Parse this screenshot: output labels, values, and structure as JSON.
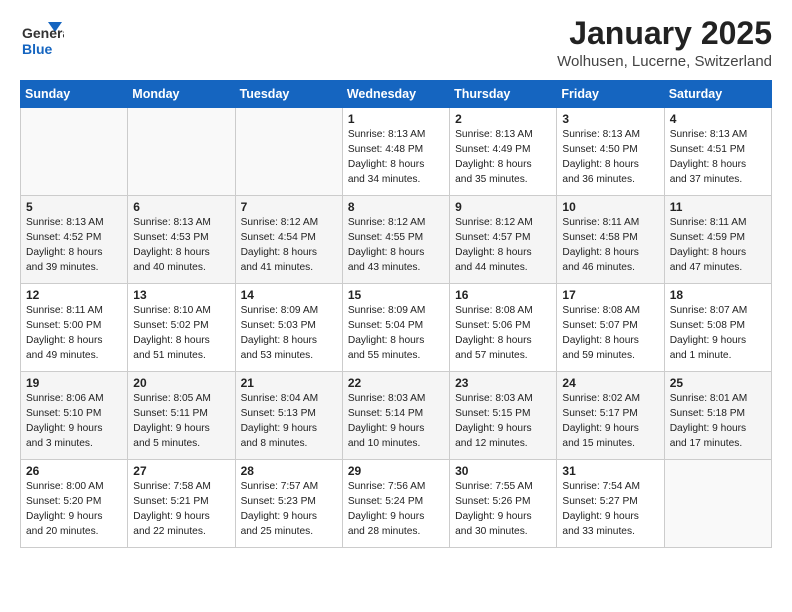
{
  "header": {
    "logo_general": "General",
    "logo_blue": "Blue",
    "month_title": "January 2025",
    "location": "Wolhusen, Lucerne, Switzerland"
  },
  "weekdays": [
    "Sunday",
    "Monday",
    "Tuesday",
    "Wednesday",
    "Thursday",
    "Friday",
    "Saturday"
  ],
  "weeks": [
    [
      {
        "day": "",
        "info": ""
      },
      {
        "day": "",
        "info": ""
      },
      {
        "day": "",
        "info": ""
      },
      {
        "day": "1",
        "info": "Sunrise: 8:13 AM\nSunset: 4:48 PM\nDaylight: 8 hours\nand 34 minutes."
      },
      {
        "day": "2",
        "info": "Sunrise: 8:13 AM\nSunset: 4:49 PM\nDaylight: 8 hours\nand 35 minutes."
      },
      {
        "day": "3",
        "info": "Sunrise: 8:13 AM\nSunset: 4:50 PM\nDaylight: 8 hours\nand 36 minutes."
      },
      {
        "day": "4",
        "info": "Sunrise: 8:13 AM\nSunset: 4:51 PM\nDaylight: 8 hours\nand 37 minutes."
      }
    ],
    [
      {
        "day": "5",
        "info": "Sunrise: 8:13 AM\nSunset: 4:52 PM\nDaylight: 8 hours\nand 39 minutes."
      },
      {
        "day": "6",
        "info": "Sunrise: 8:13 AM\nSunset: 4:53 PM\nDaylight: 8 hours\nand 40 minutes."
      },
      {
        "day": "7",
        "info": "Sunrise: 8:12 AM\nSunset: 4:54 PM\nDaylight: 8 hours\nand 41 minutes."
      },
      {
        "day": "8",
        "info": "Sunrise: 8:12 AM\nSunset: 4:55 PM\nDaylight: 8 hours\nand 43 minutes."
      },
      {
        "day": "9",
        "info": "Sunrise: 8:12 AM\nSunset: 4:57 PM\nDaylight: 8 hours\nand 44 minutes."
      },
      {
        "day": "10",
        "info": "Sunrise: 8:11 AM\nSunset: 4:58 PM\nDaylight: 8 hours\nand 46 minutes."
      },
      {
        "day": "11",
        "info": "Sunrise: 8:11 AM\nSunset: 4:59 PM\nDaylight: 8 hours\nand 47 minutes."
      }
    ],
    [
      {
        "day": "12",
        "info": "Sunrise: 8:11 AM\nSunset: 5:00 PM\nDaylight: 8 hours\nand 49 minutes."
      },
      {
        "day": "13",
        "info": "Sunrise: 8:10 AM\nSunset: 5:02 PM\nDaylight: 8 hours\nand 51 minutes."
      },
      {
        "day": "14",
        "info": "Sunrise: 8:09 AM\nSunset: 5:03 PM\nDaylight: 8 hours\nand 53 minutes."
      },
      {
        "day": "15",
        "info": "Sunrise: 8:09 AM\nSunset: 5:04 PM\nDaylight: 8 hours\nand 55 minutes."
      },
      {
        "day": "16",
        "info": "Sunrise: 8:08 AM\nSunset: 5:06 PM\nDaylight: 8 hours\nand 57 minutes."
      },
      {
        "day": "17",
        "info": "Sunrise: 8:08 AM\nSunset: 5:07 PM\nDaylight: 8 hours\nand 59 minutes."
      },
      {
        "day": "18",
        "info": "Sunrise: 8:07 AM\nSunset: 5:08 PM\nDaylight: 9 hours\nand 1 minute."
      }
    ],
    [
      {
        "day": "19",
        "info": "Sunrise: 8:06 AM\nSunset: 5:10 PM\nDaylight: 9 hours\nand 3 minutes."
      },
      {
        "day": "20",
        "info": "Sunrise: 8:05 AM\nSunset: 5:11 PM\nDaylight: 9 hours\nand 5 minutes."
      },
      {
        "day": "21",
        "info": "Sunrise: 8:04 AM\nSunset: 5:13 PM\nDaylight: 9 hours\nand 8 minutes."
      },
      {
        "day": "22",
        "info": "Sunrise: 8:03 AM\nSunset: 5:14 PM\nDaylight: 9 hours\nand 10 minutes."
      },
      {
        "day": "23",
        "info": "Sunrise: 8:03 AM\nSunset: 5:15 PM\nDaylight: 9 hours\nand 12 minutes."
      },
      {
        "day": "24",
        "info": "Sunrise: 8:02 AM\nSunset: 5:17 PM\nDaylight: 9 hours\nand 15 minutes."
      },
      {
        "day": "25",
        "info": "Sunrise: 8:01 AM\nSunset: 5:18 PM\nDaylight: 9 hours\nand 17 minutes."
      }
    ],
    [
      {
        "day": "26",
        "info": "Sunrise: 8:00 AM\nSunset: 5:20 PM\nDaylight: 9 hours\nand 20 minutes."
      },
      {
        "day": "27",
        "info": "Sunrise: 7:58 AM\nSunset: 5:21 PM\nDaylight: 9 hours\nand 22 minutes."
      },
      {
        "day": "28",
        "info": "Sunrise: 7:57 AM\nSunset: 5:23 PM\nDaylight: 9 hours\nand 25 minutes."
      },
      {
        "day": "29",
        "info": "Sunrise: 7:56 AM\nSunset: 5:24 PM\nDaylight: 9 hours\nand 28 minutes."
      },
      {
        "day": "30",
        "info": "Sunrise: 7:55 AM\nSunset: 5:26 PM\nDaylight: 9 hours\nand 30 minutes."
      },
      {
        "day": "31",
        "info": "Sunrise: 7:54 AM\nSunset: 5:27 PM\nDaylight: 9 hours\nand 33 minutes."
      },
      {
        "day": "",
        "info": ""
      }
    ]
  ]
}
